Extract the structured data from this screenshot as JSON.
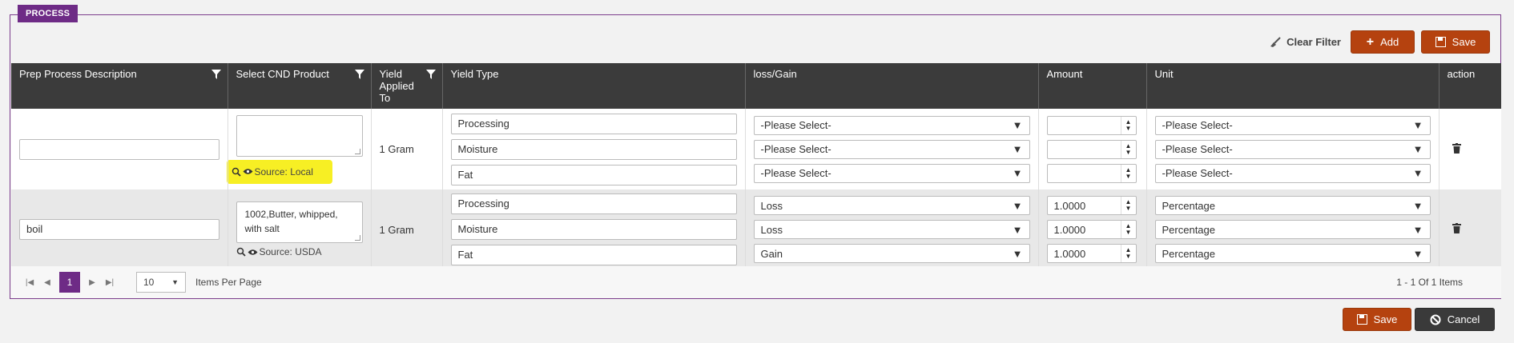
{
  "panel": {
    "legend": "PROCESS"
  },
  "toolbar": {
    "clear_filter": "Clear Filter",
    "add": "Add",
    "save": "Save"
  },
  "columns": [
    "Prep Process Description",
    "Select CND Product",
    "Yield Applied To",
    "Yield Type",
    "loss/Gain",
    "Amount",
    "Unit",
    "action"
  ],
  "rows": [
    {
      "description": "",
      "product": "",
      "source": "Source: Local",
      "applied_to": "1 Gram",
      "yields": [
        {
          "type": "Processing",
          "lossgain": "-Please Select-",
          "amount": "",
          "unit": "-Please Select-"
        },
        {
          "type": "Moisture",
          "lossgain": "-Please Select-",
          "amount": "",
          "unit": "-Please Select-"
        },
        {
          "type": "Fat",
          "lossgain": "-Please Select-",
          "amount": "",
          "unit": "-Please Select-"
        }
      ]
    },
    {
      "description": "boil",
      "product": "1002,Butter, whipped, with salt",
      "source": "Source: USDA",
      "applied_to": "1 Gram",
      "yields": [
        {
          "type": "Processing",
          "lossgain": "Loss",
          "amount": "1.0000",
          "unit": "Percentage"
        },
        {
          "type": "Moisture",
          "lossgain": "Loss",
          "amount": "1.0000",
          "unit": "Percentage"
        },
        {
          "type": "Fat",
          "lossgain": "Gain",
          "amount": "1.0000",
          "unit": "Percentage"
        }
      ]
    }
  ],
  "pager": {
    "current": "1",
    "per_page": "10",
    "per_page_label": "Items Per Page",
    "info": "1 - 1 Of 1 Items"
  },
  "footer": {
    "save": "Save",
    "cancel": "Cancel"
  },
  "colors": {
    "accent": "#6e2b86",
    "action": "#b5420f",
    "header": "#3b3b3b",
    "highlight": "#f7ef24"
  }
}
